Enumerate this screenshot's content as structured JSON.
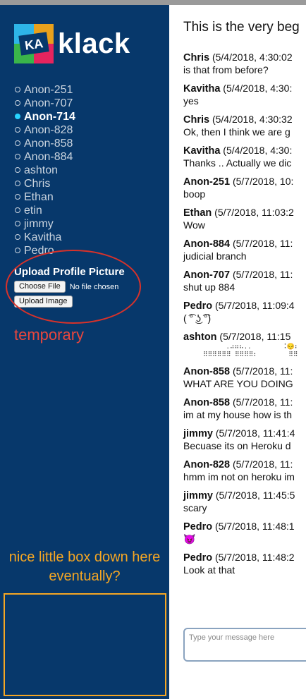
{
  "app": {
    "name": "klack",
    "logo_mark_text": "KA"
  },
  "sidebar": {
    "users": [
      {
        "name": "Anon-251",
        "active": false
      },
      {
        "name": "Anon-707",
        "active": false
      },
      {
        "name": "Anon-714",
        "active": true
      },
      {
        "name": "Anon-828",
        "active": false
      },
      {
        "name": "Anon-858",
        "active": false
      },
      {
        "name": "Anon-884",
        "active": false
      },
      {
        "name": "ashton",
        "active": false
      },
      {
        "name": "Chris",
        "active": false
      },
      {
        "name": "Ethan",
        "active": false
      },
      {
        "name": "etin",
        "active": false
      },
      {
        "name": "jimmy",
        "active": false
      },
      {
        "name": "Kavitha",
        "active": false
      },
      {
        "name": "Pedro",
        "active": false
      }
    ],
    "upload": {
      "title": "Upload Profile Picture",
      "choose_file_label": "Choose File",
      "no_file_text": "No file chosen",
      "upload_button_label": "Upload Image"
    },
    "temporary_note": "temporary",
    "box_note": "nice little box down here eventually?"
  },
  "chat": {
    "welcome": "This is the very beg",
    "messages": [
      {
        "author": "Chris",
        "time": "(5/4/2018, 4:30:02",
        "text": "is that from before?"
      },
      {
        "author": "Kavitha",
        "time": "(5/4/2018, 4:30:",
        "text": "yes"
      },
      {
        "author": "Chris",
        "time": "(5/4/2018, 4:30:32",
        "text": "Ok, then I think we are g"
      },
      {
        "author": "Kavitha",
        "time": "(5/4/2018, 4:30:",
        "text": "Thanks .. Actually we dic"
      },
      {
        "author": "Anon-251",
        "time": "(5/7/2018, 10:",
        "text": "boop"
      },
      {
        "author": "Ethan",
        "time": "(5/7/2018, 11:03:2",
        "text": "Wow"
      },
      {
        "author": "Anon-884",
        "time": "(5/7/2018, 11:",
        "text": "judicial branch"
      },
      {
        "author": "Anon-707",
        "time": "(5/7/2018, 11:",
        "text": "shut up 884"
      },
      {
        "author": "Pedro",
        "time": "(5/7/2018, 11:09:4",
        "text": "( ͡° ͜ʖ ͡°)"
      },
      {
        "author": "ashton",
        "time": "(5/7/2018, 11:15",
        "text": "",
        "ascii": "      .⠴⠶⠦..        ⠨😔⠆\n⠿⠿⠿⠿⠿⠿ ⠿⠿⠿⠿⠆        ⠿⠿"
      },
      {
        "author": "Anon-858",
        "time": "(5/7/2018, 11:",
        "text": "WHAT ARE YOU DOING"
      },
      {
        "author": "Anon-858",
        "time": "(5/7/2018, 11:",
        "text": "im at my house how is th"
      },
      {
        "author": "jimmy",
        "time": "(5/7/2018, 11:41:4",
        "text": "Becuase its on Heroku d"
      },
      {
        "author": "Anon-828",
        "time": "(5/7/2018, 11:",
        "text": "hmm im not on heroku im"
      },
      {
        "author": "jimmy",
        "time": "(5/7/2018, 11:45:5",
        "text": "scary"
      },
      {
        "author": "Pedro",
        "time": "(5/7/2018, 11:48:1",
        "text": "😈"
      },
      {
        "author": "Pedro",
        "time": "(5/7/2018, 11:48:2",
        "text": "Look at that"
      }
    ],
    "composer_placeholder": "Type your message here"
  },
  "colors": {
    "sidebar_bg": "#07386b",
    "active_dot": "#27d3ff",
    "annotation_red": "#d8322a",
    "annotation_orange": "#f5a623"
  }
}
